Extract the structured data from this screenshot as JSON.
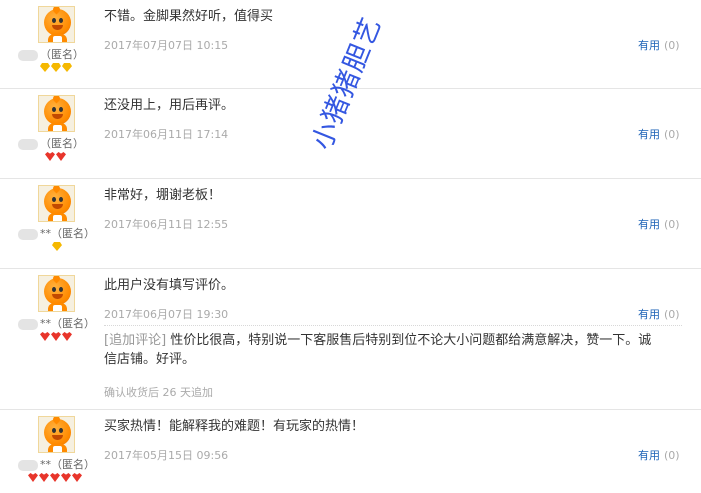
{
  "reviews": [
    {
      "text": "不错。金脚果然好听，值得买",
      "date": "2017年07月07日 10:15",
      "nick": "（匿名）",
      "useful_label": "有用",
      "useful_count": "(0)",
      "rank": "yellow3"
    },
    {
      "text": "还没用上，用后再评。",
      "date": "2017年06月11日 17:14",
      "nick": "（匿名）",
      "useful_label": "有用",
      "useful_count": "(0)",
      "rank": "red2"
    },
    {
      "text": "非常好，堋谢老板！",
      "date": "2017年06月11日 12:55",
      "nick": "**（匿名）",
      "useful_label": "有用",
      "useful_count": "(0)",
      "rank": "yellow1"
    },
    {
      "text": "此用户没有填写评价。",
      "date": "2017年06月07日 19:30",
      "nick": "**（匿名）",
      "useful_label": "有用",
      "useful_count": "(0)",
      "rank": "red3",
      "append_tag": "[追加评论]",
      "append_text": "性价比很高，特别说一下客服售后特别到位不论大小问题都给满意解决，赞一下。诚信店铺。好评。",
      "append_note": "确认收货后 26 天追加"
    },
    {
      "text": "买家热情！能解释我的难题！有玩家的热情！",
      "date": "2017年05月15日 09:56",
      "nick": "**（匿名）",
      "useful_label": "有用",
      "useful_count": "(0)",
      "rank": "red5"
    }
  ],
  "watermark": "小猪猪胆艺"
}
